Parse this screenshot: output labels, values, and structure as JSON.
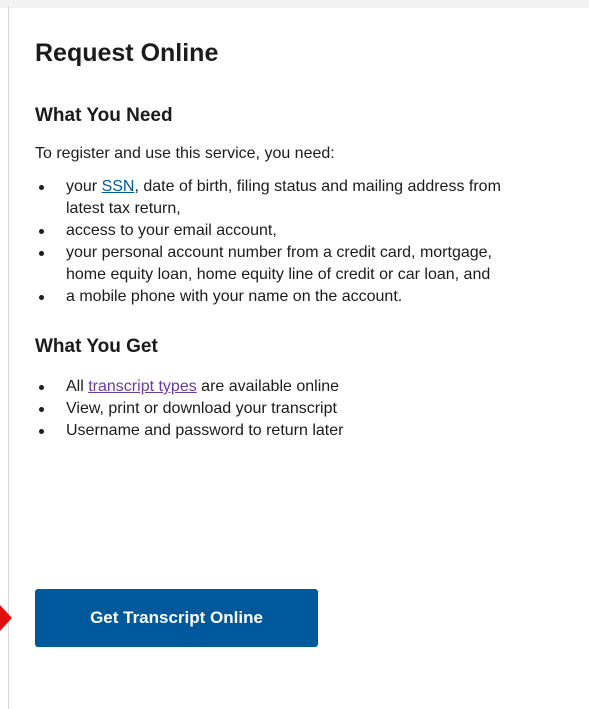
{
  "section": {
    "title": "Request Online"
  },
  "need": {
    "heading": "What You Need",
    "intro": "To register and use this service, you need:",
    "items": [
      {
        "prefix": "your ",
        "link": "SSN",
        "suffix": ", date of birth, filing status and mailing address from latest tax return,"
      },
      {
        "text": "access to your email account,"
      },
      {
        "text": "your personal account number from a credit card, mortgage, home equity loan, home equity line of credit or car loan, and"
      },
      {
        "text": "a mobile phone with your name on the account."
      }
    ]
  },
  "get": {
    "heading": "What You Get",
    "items": [
      {
        "prefix": "All ",
        "link": "transcript types",
        "suffix": " are available online"
      },
      {
        "text": "View, print or download your transcript"
      },
      {
        "text": "Username and password to return later"
      }
    ]
  },
  "cta": {
    "label": "Get Transcript Online"
  },
  "colors": {
    "button": "#00599c",
    "link": "#00599c",
    "visited_link": "#6a3aa0",
    "arrow": "#e01010"
  }
}
